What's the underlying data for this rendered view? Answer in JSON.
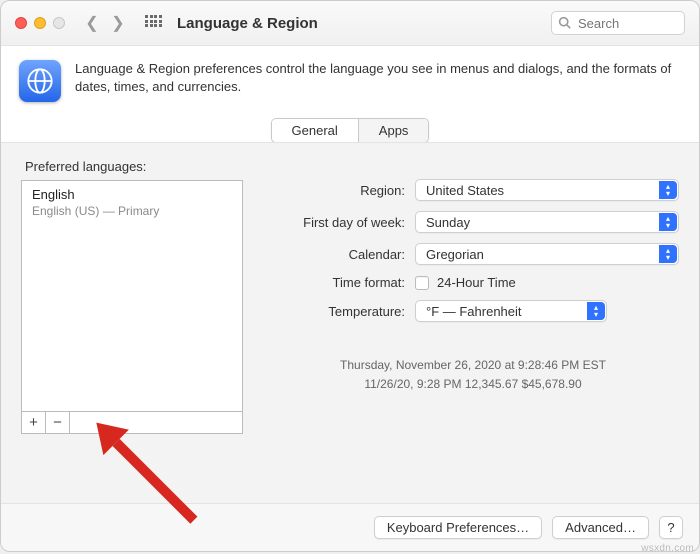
{
  "window": {
    "title": "Language & Region"
  },
  "search": {
    "placeholder": "Search"
  },
  "header": {
    "description": "Language & Region preferences control the language you see in menus and dialogs, and the formats of dates, times, and currencies."
  },
  "tabs": {
    "general": "General",
    "apps": "Apps"
  },
  "languages": {
    "section_label": "Preferred languages:",
    "items": [
      {
        "name": "English",
        "detail": "English (US) — Primary"
      }
    ],
    "add": "+",
    "remove": "−"
  },
  "settings": {
    "region_label": "Region:",
    "region_value": "United States",
    "first_day_label": "First day of week:",
    "first_day_value": "Sunday",
    "calendar_label": "Calendar:",
    "calendar_value": "Gregorian",
    "time_format_label": "Time format:",
    "time_format_checkbox": "24-Hour Time",
    "temperature_label": "Temperature:",
    "temperature_value": "°F — Fahrenheit"
  },
  "samples": {
    "line1": "Thursday, November 26, 2020 at 9:28:46 PM EST",
    "line2": "11/26/20, 9:28 PM    12,345.67    $45,678.90"
  },
  "footer": {
    "keyboard": "Keyboard Preferences…",
    "advanced": "Advanced…",
    "help": "?"
  },
  "watermark": "wsxdn.com"
}
